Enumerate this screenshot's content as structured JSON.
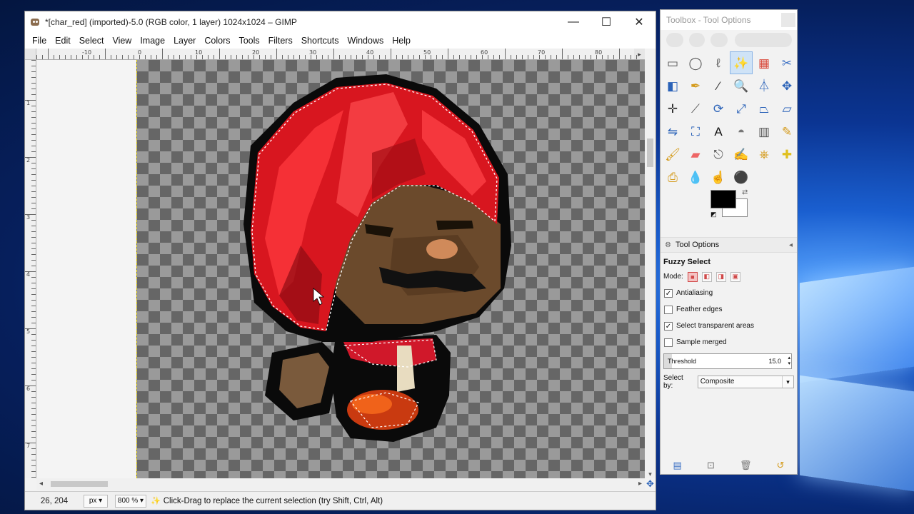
{
  "window": {
    "title": "*[char_red] (imported)-5.0 (RGB color, 1 layer) 1024x1024 – GIMP",
    "controls": {
      "minimize": "—",
      "maximize": "☐",
      "close": "✕"
    }
  },
  "menu": [
    "File",
    "Edit",
    "Select",
    "View",
    "Image",
    "Layer",
    "Colors",
    "Tools",
    "Filters",
    "Shortcuts",
    "Windows",
    "Help"
  ],
  "rulers": {
    "horizontal": [
      "-10",
      "0",
      "10",
      "20",
      "30",
      "40",
      "50",
      "60",
      "70",
      "80",
      "90"
    ],
    "vertical": [
      "1",
      "2",
      "3",
      "4",
      "5",
      "6",
      "7"
    ]
  },
  "status": {
    "coordinates": "26, 204",
    "unit": "px",
    "zoom": "800 %",
    "message": "Click-Drag to replace the current selection (try Shift, Ctrl, Alt)"
  },
  "toolbox": {
    "title": "Toolbox - Tool Options",
    "tools": [
      {
        "name": "rect-select-icon",
        "glyph": "▭",
        "color": "#555"
      },
      {
        "name": "ellipse-select-icon",
        "glyph": "◯",
        "color": "#555"
      },
      {
        "name": "free-select-icon",
        "glyph": "ℓ",
        "color": "#555"
      },
      {
        "name": "fuzzy-select-icon",
        "glyph": "✨",
        "color": "#3a6fc4",
        "active": true
      },
      {
        "name": "select-by-color-icon",
        "glyph": "▦",
        "color": "#d8483a"
      },
      {
        "name": "scissors-select-icon",
        "glyph": "✂",
        "color": "#3a6fc4"
      },
      {
        "name": "foreground-select-icon",
        "glyph": "◧",
        "color": "#2a62b8"
      },
      {
        "name": "paths-icon",
        "glyph": "✒",
        "color": "#d49a1a"
      },
      {
        "name": "color-picker-icon",
        "glyph": "⁄",
        "color": "#333"
      },
      {
        "name": "zoom-icon",
        "glyph": "🔍",
        "color": "#3a6fc4"
      },
      {
        "name": "measure-icon",
        "glyph": "⏃",
        "color": "#2a62b8"
      },
      {
        "name": "move-icon",
        "glyph": "✥",
        "color": "#2a62b8"
      },
      {
        "name": "align-icon",
        "glyph": "✛",
        "color": "#333"
      },
      {
        "name": "crop-icon",
        "glyph": "⟋",
        "color": "#555"
      },
      {
        "name": "rotate-icon",
        "glyph": "⟳",
        "color": "#2a62b8"
      },
      {
        "name": "scale-icon",
        "glyph": "⤢",
        "color": "#2a62b8"
      },
      {
        "name": "shear-icon",
        "glyph": "⏢",
        "color": "#2a62b8"
      },
      {
        "name": "perspective-icon",
        "glyph": "⏥",
        "color": "#2a62b8"
      },
      {
        "name": "flip-icon",
        "glyph": "⇋",
        "color": "#2a62b8"
      },
      {
        "name": "cage-transform-icon",
        "glyph": "⛶",
        "color": "#2a62b8"
      },
      {
        "name": "text-icon",
        "glyph": "A",
        "color": "#111"
      },
      {
        "name": "bucket-fill-icon",
        "glyph": "◓",
        "color": "#777"
      },
      {
        "name": "blend-icon",
        "glyph": "▥",
        "color": "#555"
      },
      {
        "name": "pencil-icon",
        "glyph": "✎",
        "color": "#d49a1a"
      },
      {
        "name": "paintbrush-icon",
        "glyph": "🖌",
        "color": "#d49a1a"
      },
      {
        "name": "eraser-icon",
        "glyph": "▰",
        "color": "#e66"
      },
      {
        "name": "airbrush-icon",
        "glyph": "⎋",
        "color": "#555"
      },
      {
        "name": "ink-icon",
        "glyph": "✍",
        "color": "#2a62b8"
      },
      {
        "name": "clone-icon",
        "glyph": "⎈",
        "color": "#d49a1a"
      },
      {
        "name": "heal-icon",
        "glyph": "✚",
        "color": "#e0c020"
      },
      {
        "name": "perspective-clone-icon",
        "glyph": "⎙",
        "color": "#d49a1a"
      },
      {
        "name": "blur-icon",
        "glyph": "💧",
        "color": "#3a6fc4"
      },
      {
        "name": "smudge-icon",
        "glyph": "☝",
        "color": "#c9872a"
      },
      {
        "name": "dodge-burn-icon",
        "glyph": "⚫",
        "color": "#333"
      }
    ],
    "panel_tab": "Tool Options",
    "options": {
      "tool_name": "Fuzzy Select",
      "mode_label": "Mode:",
      "antialiasing": "Antialiasing",
      "feather_edges": "Feather edges",
      "select_transparent": "Select transparent areas",
      "sample_merged": "Sample merged",
      "threshold_label": "Threshold",
      "threshold_value": "15.0",
      "threshold_fraction": 0.06,
      "select_by_label": "Select by:",
      "select_by_value": "Composite"
    },
    "checks": {
      "antialiasing": true,
      "feather_edges": false,
      "select_transparent": true,
      "sample_merged": false
    }
  },
  "colors": {
    "turban_red": "#e01828",
    "skin": "#6b4a2c",
    "outline": "#0a0a0a"
  }
}
